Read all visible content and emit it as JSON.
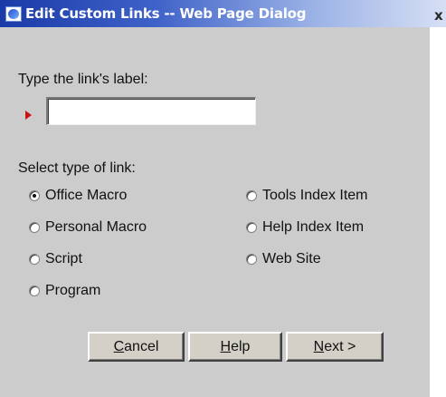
{
  "window": {
    "title": "Edit Custom Links -- Web Page Dialog",
    "close_glyph": "x"
  },
  "form": {
    "label_prompt": "Type the link's label:",
    "label_value": "",
    "type_prompt": "Select type of link:",
    "link_types": [
      {
        "label": "Office Macro",
        "checked": true
      },
      {
        "label": "Personal Macro",
        "checked": false
      },
      {
        "label": "Script",
        "checked": false
      },
      {
        "label": "Program",
        "checked": false
      },
      {
        "label": "Tools Index Item",
        "checked": false
      },
      {
        "label": "Help Index Item",
        "checked": false
      },
      {
        "label": "Web Site",
        "checked": false
      }
    ]
  },
  "buttons": {
    "cancel": {
      "accel": "C",
      "rest": "ancel"
    },
    "help": {
      "accel": "H",
      "rest": "elp"
    },
    "next": {
      "accel": "N",
      "rest": "ext >"
    }
  },
  "colors": {
    "titlebar_start": "#1a3aa8",
    "titlebar_end": "#d6dff4",
    "panel": "#cccccc",
    "required_marker": "#cc1111"
  },
  "icons": {
    "window": "ie-window-icon",
    "required": "red-triangle-marker-icon",
    "close": "close-icon"
  }
}
